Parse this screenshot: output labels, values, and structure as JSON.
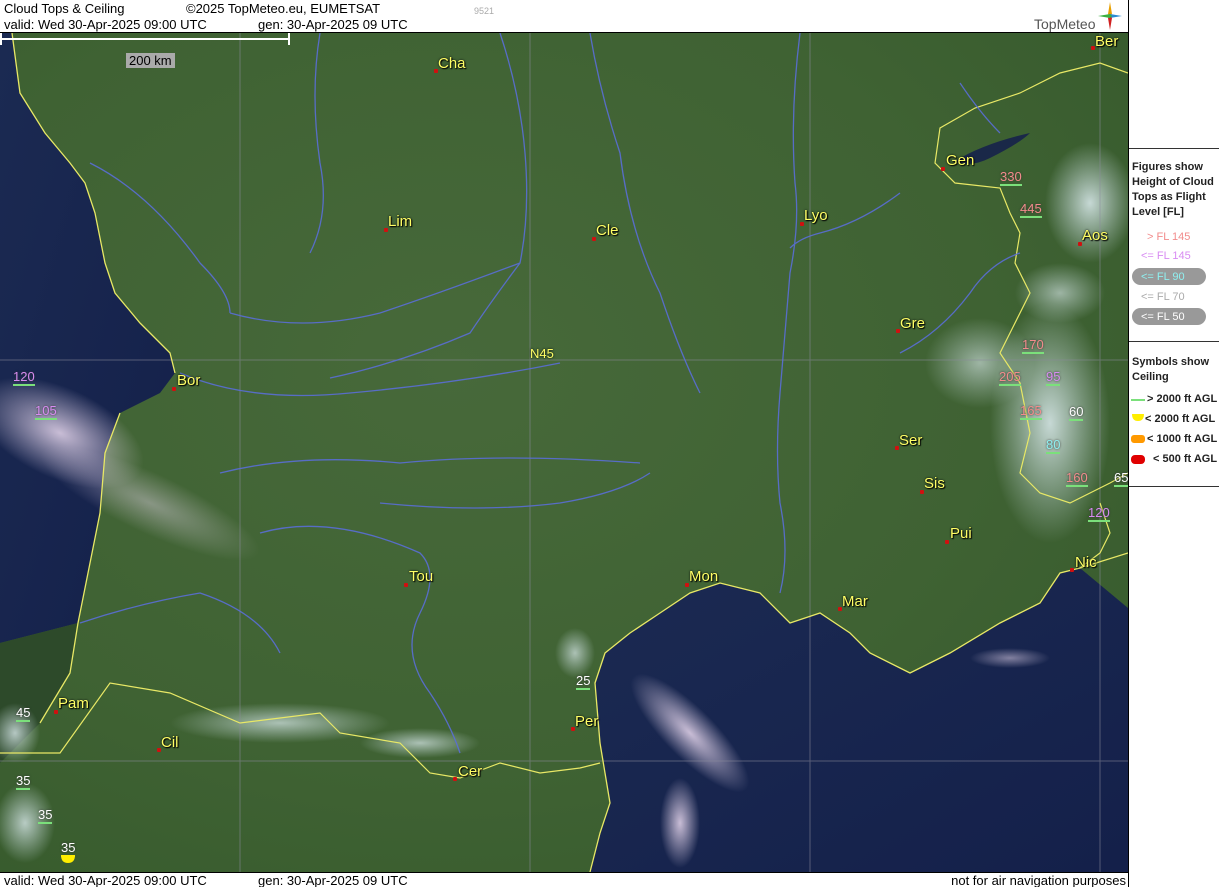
{
  "header": {
    "title": "Cloud Tops & Ceiling",
    "copyright": "©2025 TopMeteo.eu, EUMETSAT",
    "code": "9521",
    "valid": "valid:  Wed   30-Apr-2025   09:00 UTC",
    "generated": "gen: 30-Apr-2025 09 UTC",
    "logo_text": "TopMeteo"
  },
  "map": {
    "scale_label": "200 km",
    "grid_label": "N45",
    "cities": [
      {
        "name": "Cha"
      },
      {
        "name": "Ber"
      },
      {
        "name": "Gen"
      },
      {
        "name": "Lim"
      },
      {
        "name": "Cle"
      },
      {
        "name": "Lyo"
      },
      {
        "name": "Aos"
      },
      {
        "name": "Gre"
      },
      {
        "name": "Bor"
      },
      {
        "name": "Ser"
      },
      {
        "name": "Sis"
      },
      {
        "name": "Pui"
      },
      {
        "name": "Tou"
      },
      {
        "name": "Mon"
      },
      {
        "name": "Mar"
      },
      {
        "name": "Nic"
      },
      {
        "name": "Pam"
      },
      {
        "name": "Per"
      },
      {
        "name": "Cil"
      },
      {
        "name": "Cer"
      }
    ],
    "flight_levels": [
      {
        "value": "330",
        "class": "pink"
      },
      {
        "value": "445",
        "class": "pink"
      },
      {
        "value": "170",
        "class": "pink"
      },
      {
        "value": "205",
        "class": "pink"
      },
      {
        "value": "95",
        "class": "violet"
      },
      {
        "value": "165",
        "class": "pink"
      },
      {
        "value": "60",
        "class": "white"
      },
      {
        "value": "80",
        "class": "cyan"
      },
      {
        "value": "160",
        "class": "pink"
      },
      {
        "value": "65",
        "class": "white"
      },
      {
        "value": "120",
        "class": "violet"
      },
      {
        "value": "120",
        "class": "violet"
      },
      {
        "value": "105",
        "class": "violet"
      },
      {
        "value": "25",
        "class": "white"
      },
      {
        "value": "45",
        "class": "white"
      },
      {
        "value": "35",
        "class": "white"
      },
      {
        "value": "35",
        "class": "white"
      },
      {
        "value": "35",
        "class": "white"
      }
    ]
  },
  "legend": {
    "figures_heading": "Figures show Height of Cloud Tops as Flight Level  [FL]",
    "figures_lines": [
      "Figures show",
      "Height of Cloud",
      "Tops as Flight",
      "Level  [FL]"
    ],
    "fl_items": [
      "> FL 145",
      "<= FL 145",
      "<= FL 90",
      "<= FL 70",
      "<= FL 50"
    ],
    "symbols_lines": [
      "Symbols show",
      "Ceiling"
    ],
    "symbols": [
      "> 2000 ft AGL",
      "< 2000 ft AGL",
      "< 1000 ft AGL",
      "< 500 ft AGL"
    ],
    "colors": {
      "green": "#7be07b",
      "yellow": "#ffee00",
      "orange": "#ff9900",
      "red": "#e00000"
    }
  },
  "footer": {
    "valid": "valid:  Wed   30-Apr-2025   09:00 UTC",
    "generated": "gen: 30-Apr-2025 09 UTC",
    "disclaimer": "not for air navigation purposes"
  }
}
